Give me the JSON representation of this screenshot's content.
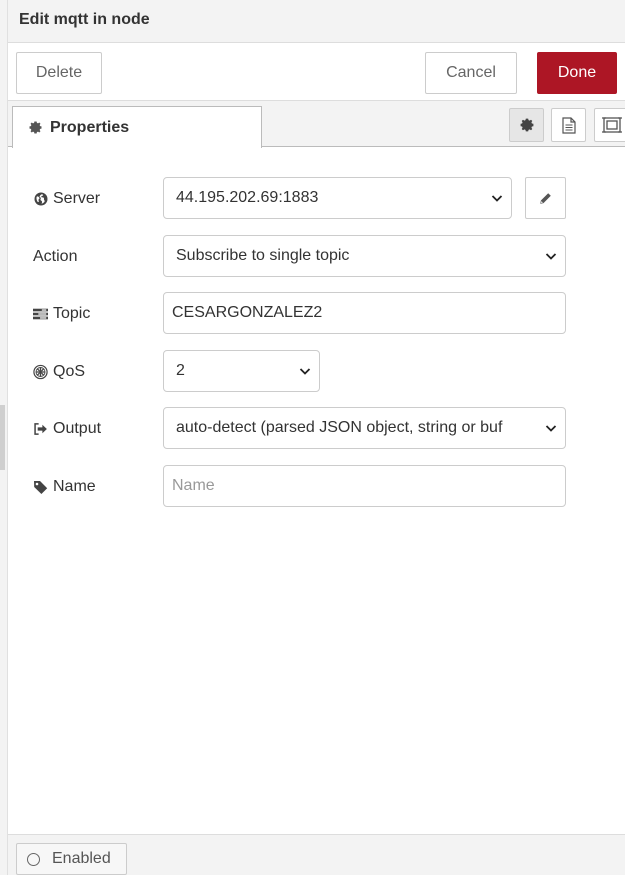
{
  "header": {
    "title": "Edit mqtt in node"
  },
  "toolbar": {
    "delete_label": "Delete",
    "cancel_label": "Cancel",
    "done_label": "Done"
  },
  "tabs": {
    "properties_label": "Properties",
    "icon_buttons": [
      "gear-icon",
      "file-text-icon",
      "frame-icon"
    ]
  },
  "form": {
    "server": {
      "label": "Server",
      "value": "44.195.202.69:1883",
      "icon": "globe-icon"
    },
    "action": {
      "label": "Action",
      "value": "Subscribe to single topic"
    },
    "topic": {
      "label": "Topic",
      "value": "CESARGONZALEZ2",
      "icon": "tasks-icon"
    },
    "qos": {
      "label": "QoS",
      "value": "2",
      "icon": "empire-icon"
    },
    "output": {
      "label": "Output",
      "value": "auto-detect (parsed JSON object, string or buf",
      "icon": "sign-out-icon"
    },
    "name": {
      "label": "Name",
      "value": "",
      "placeholder": "Name",
      "icon": "tag-icon"
    }
  },
  "footer": {
    "enabled_label": "Enabled"
  },
  "colors": {
    "done": "#ad1625",
    "panel_bg": "#f3f3f3",
    "border": "#cccccc"
  }
}
